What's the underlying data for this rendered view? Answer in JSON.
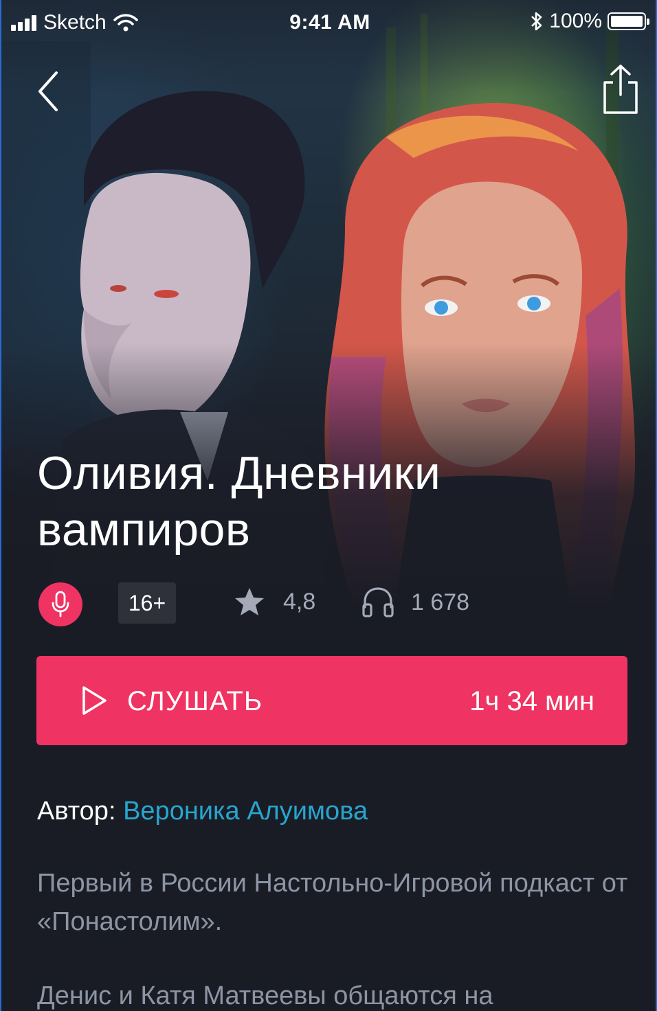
{
  "status_bar": {
    "carrier": "Sketch",
    "time": "9:41 AM",
    "battery": "100%"
  },
  "nav": {
    "back_icon": "chevron-left-icon",
    "share_icon": "share-icon"
  },
  "hero": {
    "title": "Оливия. Дневники вампиров"
  },
  "meta": {
    "type_icon": "microphone-icon",
    "age_rating": "16+",
    "rating": "4,8",
    "listens": "1 678"
  },
  "play": {
    "label": "СЛУШАТЬ",
    "duration": "1ч 34 мин"
  },
  "author": {
    "label": "Автор:",
    "name": "Вероника Алуимова"
  },
  "description": {
    "paragraphs": [
      "Первый в России Настольно-Игровой подкаст от «Понастолим».",
      "Денис и Катя Матвеевы общаются на"
    ]
  },
  "colors": {
    "accent": "#ef3362",
    "link": "#26a6cf",
    "background": "#1a1c25",
    "muted_text": "#8d95a4"
  }
}
